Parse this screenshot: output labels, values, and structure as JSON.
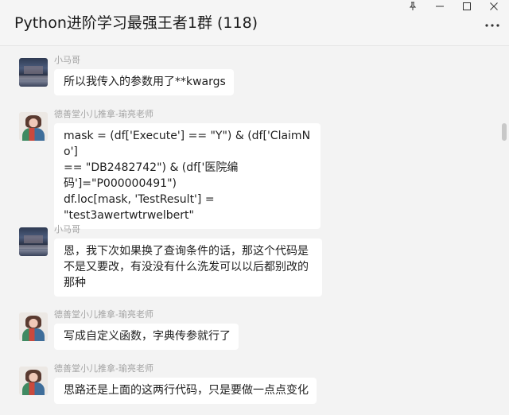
{
  "window": {
    "title": "Python进阶学习最强王者1群 (118)",
    "controls": [
      "pin-icon",
      "minimize-icon",
      "maximize-icon",
      "close-icon"
    ],
    "more_icon": "more-horizontal-icon"
  },
  "messages": [
    {
      "sender": "小马哥",
      "avatar": "avatar-a",
      "text": "所以我传入的参数用了**kwargs"
    },
    {
      "sender": "德善堂小儿推拿-瑜亮老师",
      "avatar": "avatar-b",
      "text": "mask = (df['Execute'] == \"Y\") & (df['ClaimNo']\n== \"DB2482742\") & (df['医院编\n码']=\"P000000491\")\ndf.loc[mask, 'TestResult'] =\n\"test3awertwtrwelbert\""
    },
    {
      "sender": "小马哥",
      "avatar": "avatar-a",
      "text": "恩，我下次如果换了查询条件的话，那这个代码是\n不是又要改，有没没有什么洗发可以以后都别改的\n那种"
    },
    {
      "sender": "德善堂小儿推拿-瑜亮老师",
      "avatar": "avatar-b",
      "text": "写成自定义函数，字典传参就行了"
    },
    {
      "sender": "德善堂小儿推拿-瑜亮老师",
      "avatar": "avatar-b",
      "text": "思路还是上面的这两行代码，只是要做一点点变化"
    }
  ],
  "colors": {
    "background": "#f3f3f3",
    "bubble": "#ffffff",
    "sender_name": "#a3a3a3",
    "text": "#1f1f1f"
  }
}
